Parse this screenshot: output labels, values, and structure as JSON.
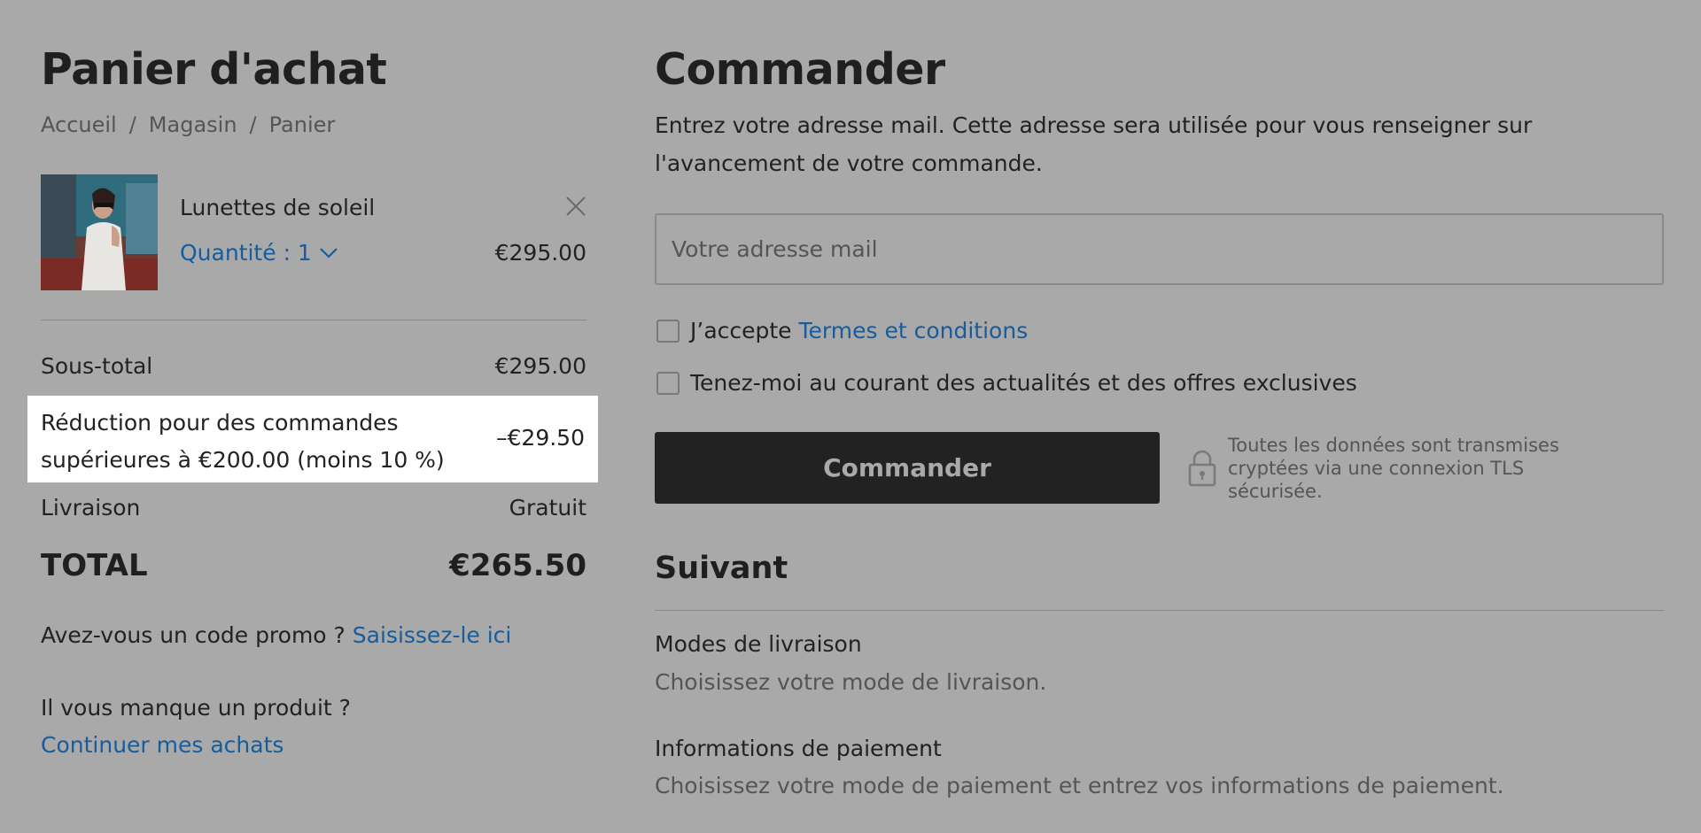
{
  "cart": {
    "title": "Panier d'achat",
    "breadcrumb": [
      "Accueil",
      "Magasin",
      "Panier"
    ],
    "breadcrumb_separator": "/",
    "item": {
      "name": "Lunettes de soleil",
      "quantity_label": "Quantité : 1",
      "price": "€295.00"
    },
    "subtotal": {
      "label": "Sous-total",
      "value": "€295.00"
    },
    "discount": {
      "label": "Réduction pour des commandes supérieures à €200.00 (moins 10 %)",
      "value": "–€29.50"
    },
    "shipping": {
      "label": "Livraison",
      "value": "Gratuit"
    },
    "total": {
      "label": "TOTAL",
      "value": "€265.50"
    },
    "promo_question": "Avez-vous un code promo ?",
    "promo_link": "Saisissez-le ici",
    "missing_question": "Il vous manque un produit ?",
    "continue_link": "Continuer mes achats"
  },
  "checkout": {
    "title": "Commander",
    "description": "Entrez votre adresse mail. Cette adresse sera utilisée pour vous renseigner sur l'avancement de votre commande.",
    "email_placeholder": "Votre adresse mail",
    "terms_prefix": "J’accepte",
    "terms_link": "Termes et conditions",
    "newsletter_label": "Tenez-moi au courant des actualités et des offres exclusives",
    "submit_label": "Commander",
    "secure_text": "Toutes les données sont transmises cryptées via une connexion TLS sécurisée.",
    "next_title": "Suivant",
    "steps": [
      {
        "title": "Modes de livraison",
        "subtitle": "Choisissez votre mode de livraison."
      },
      {
        "title": "Informations de paiement",
        "subtitle": "Choisissez votre mode de paiement et entrez vos informations de paiement."
      }
    ]
  },
  "colors": {
    "background": "#a9a9a9",
    "link": "#175c9c",
    "button": "#222222",
    "highlight": "#ffffff"
  },
  "icons": [
    "product-thumbnail",
    "close-icon",
    "chevron-down-icon",
    "lock-icon"
  ]
}
